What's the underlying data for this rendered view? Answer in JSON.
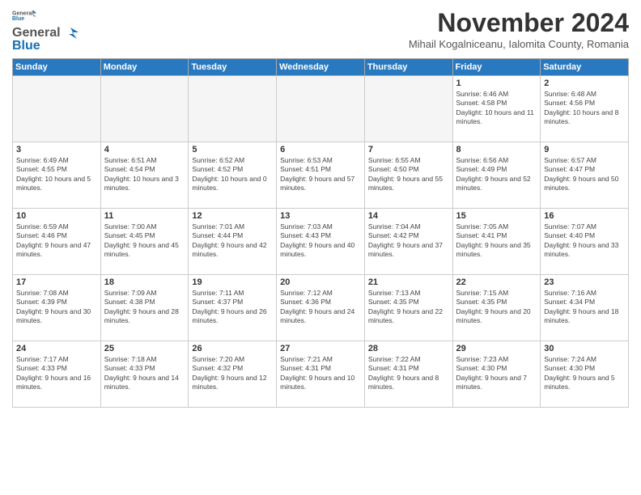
{
  "logo": {
    "general": "General",
    "blue": "Blue"
  },
  "title": "November 2024",
  "location": "Mihail Kogalniceanu, Ialomita County, Romania",
  "headers": [
    "Sunday",
    "Monday",
    "Tuesday",
    "Wednesday",
    "Thursday",
    "Friday",
    "Saturday"
  ],
  "weeks": [
    [
      {
        "day": "",
        "info": "",
        "empty": true
      },
      {
        "day": "",
        "info": "",
        "empty": true
      },
      {
        "day": "",
        "info": "",
        "empty": true
      },
      {
        "day": "",
        "info": "",
        "empty": true
      },
      {
        "day": "",
        "info": "",
        "empty": true
      },
      {
        "day": "1",
        "info": "Sunrise: 6:46 AM\nSunset: 4:58 PM\nDaylight: 10 hours and 11 minutes."
      },
      {
        "day": "2",
        "info": "Sunrise: 6:48 AM\nSunset: 4:56 PM\nDaylight: 10 hours and 8 minutes."
      }
    ],
    [
      {
        "day": "3",
        "info": "Sunrise: 6:49 AM\nSunset: 4:55 PM\nDaylight: 10 hours and 5 minutes."
      },
      {
        "day": "4",
        "info": "Sunrise: 6:51 AM\nSunset: 4:54 PM\nDaylight: 10 hours and 3 minutes."
      },
      {
        "day": "5",
        "info": "Sunrise: 6:52 AM\nSunset: 4:52 PM\nDaylight: 10 hours and 0 minutes."
      },
      {
        "day": "6",
        "info": "Sunrise: 6:53 AM\nSunset: 4:51 PM\nDaylight: 9 hours and 57 minutes."
      },
      {
        "day": "7",
        "info": "Sunrise: 6:55 AM\nSunset: 4:50 PM\nDaylight: 9 hours and 55 minutes."
      },
      {
        "day": "8",
        "info": "Sunrise: 6:56 AM\nSunset: 4:49 PM\nDaylight: 9 hours and 52 minutes."
      },
      {
        "day": "9",
        "info": "Sunrise: 6:57 AM\nSunset: 4:47 PM\nDaylight: 9 hours and 50 minutes."
      }
    ],
    [
      {
        "day": "10",
        "info": "Sunrise: 6:59 AM\nSunset: 4:46 PM\nDaylight: 9 hours and 47 minutes."
      },
      {
        "day": "11",
        "info": "Sunrise: 7:00 AM\nSunset: 4:45 PM\nDaylight: 9 hours and 45 minutes."
      },
      {
        "day": "12",
        "info": "Sunrise: 7:01 AM\nSunset: 4:44 PM\nDaylight: 9 hours and 42 minutes."
      },
      {
        "day": "13",
        "info": "Sunrise: 7:03 AM\nSunset: 4:43 PM\nDaylight: 9 hours and 40 minutes."
      },
      {
        "day": "14",
        "info": "Sunrise: 7:04 AM\nSunset: 4:42 PM\nDaylight: 9 hours and 37 minutes."
      },
      {
        "day": "15",
        "info": "Sunrise: 7:05 AM\nSunset: 4:41 PM\nDaylight: 9 hours and 35 minutes."
      },
      {
        "day": "16",
        "info": "Sunrise: 7:07 AM\nSunset: 4:40 PM\nDaylight: 9 hours and 33 minutes."
      }
    ],
    [
      {
        "day": "17",
        "info": "Sunrise: 7:08 AM\nSunset: 4:39 PM\nDaylight: 9 hours and 30 minutes."
      },
      {
        "day": "18",
        "info": "Sunrise: 7:09 AM\nSunset: 4:38 PM\nDaylight: 9 hours and 28 minutes."
      },
      {
        "day": "19",
        "info": "Sunrise: 7:11 AM\nSunset: 4:37 PM\nDaylight: 9 hours and 26 minutes."
      },
      {
        "day": "20",
        "info": "Sunrise: 7:12 AM\nSunset: 4:36 PM\nDaylight: 9 hours and 24 minutes."
      },
      {
        "day": "21",
        "info": "Sunrise: 7:13 AM\nSunset: 4:35 PM\nDaylight: 9 hours and 22 minutes."
      },
      {
        "day": "22",
        "info": "Sunrise: 7:15 AM\nSunset: 4:35 PM\nDaylight: 9 hours and 20 minutes."
      },
      {
        "day": "23",
        "info": "Sunrise: 7:16 AM\nSunset: 4:34 PM\nDaylight: 9 hours and 18 minutes."
      }
    ],
    [
      {
        "day": "24",
        "info": "Sunrise: 7:17 AM\nSunset: 4:33 PM\nDaylight: 9 hours and 16 minutes."
      },
      {
        "day": "25",
        "info": "Sunrise: 7:18 AM\nSunset: 4:33 PM\nDaylight: 9 hours and 14 minutes."
      },
      {
        "day": "26",
        "info": "Sunrise: 7:20 AM\nSunset: 4:32 PM\nDaylight: 9 hours and 12 minutes."
      },
      {
        "day": "27",
        "info": "Sunrise: 7:21 AM\nSunset: 4:31 PM\nDaylight: 9 hours and 10 minutes."
      },
      {
        "day": "28",
        "info": "Sunrise: 7:22 AM\nSunset: 4:31 PM\nDaylight: 9 hours and 8 minutes."
      },
      {
        "day": "29",
        "info": "Sunrise: 7:23 AM\nSunset: 4:30 PM\nDaylight: 9 hours and 7 minutes."
      },
      {
        "day": "30",
        "info": "Sunrise: 7:24 AM\nSunset: 4:30 PM\nDaylight: 9 hours and 5 minutes."
      }
    ]
  ]
}
